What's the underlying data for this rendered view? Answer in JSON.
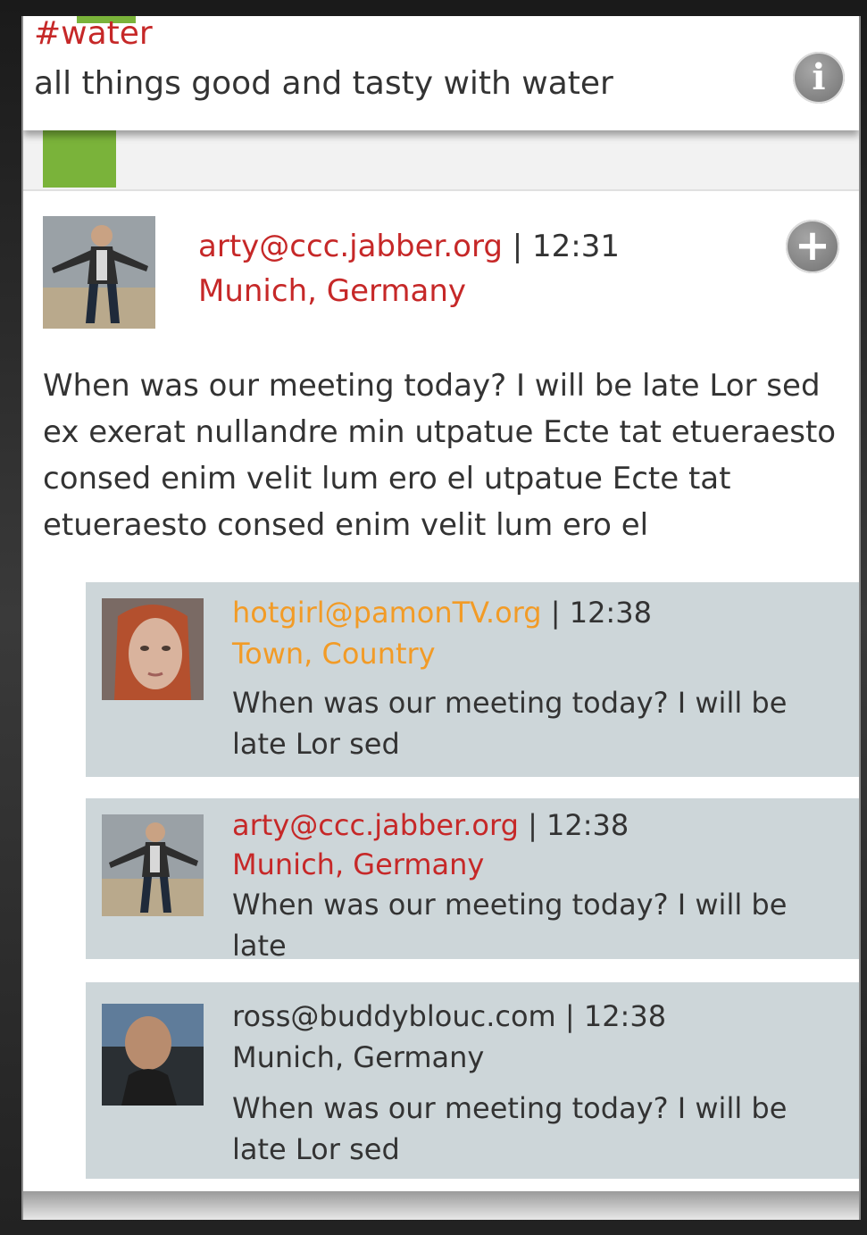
{
  "header": {
    "hashtag": "#water",
    "description": "all things good and tasty with water",
    "info_icon": "info-icon",
    "accent_color": "#7ab33a"
  },
  "main_post": {
    "author": "arty@ccc.jabber.org",
    "separator": "|",
    "time": "12:31",
    "location": "Munich, Germany",
    "text": "When was our meeting today? I will be late Lor sed ex exerat nullandre min utpatue Ecte tat etueraesto consed enim velit lum ero el utpatue Ecte tat etueraesto consed enim velit lum ero el",
    "add_icon": "plus-icon"
  },
  "replies": [
    {
      "author": "hotgirl@pamonTV.org",
      "separator": "|",
      "time": "12:38",
      "location": "Town, Country",
      "text": "When was our meeting today? I will be late Lor sed",
      "name_color": "#f29b26"
    },
    {
      "author": "arty@ccc.jabber.org",
      "separator": "|",
      "time": "12:38",
      "location": "Munich, Germany",
      "text": "When was our meeting today? I will be late",
      "name_color": "#c62828"
    },
    {
      "author": "ross@buddyblouc.com",
      "separator": "|",
      "time": "12:38",
      "location": "Munich, Germany",
      "text": "When was our meeting today? I will be late Lor sed",
      "name_color": "#333333"
    }
  ]
}
